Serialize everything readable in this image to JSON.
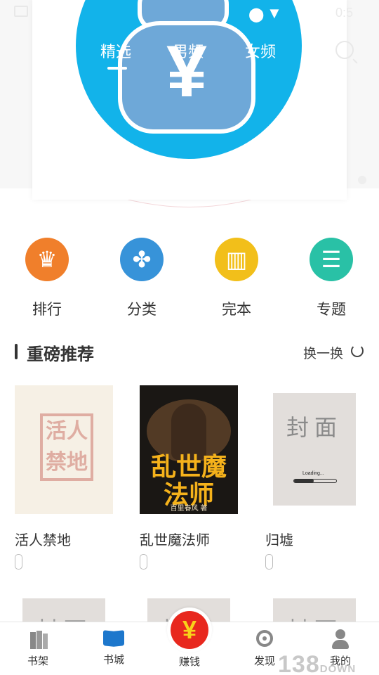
{
  "status_bar": {
    "time": "0:5"
  },
  "banner": {
    "symbol": "¥"
  },
  "tabs": [
    {
      "label": "精选",
      "active": true
    },
    {
      "label": "男频",
      "active": false
    },
    {
      "label": "女频",
      "active": false
    }
  ],
  "quick_links": [
    {
      "label": "排行",
      "icon": "crown-icon",
      "color": "#f07f2b"
    },
    {
      "label": "分类",
      "icon": "clover-icon",
      "color": "#3793d9"
    },
    {
      "label": "完本",
      "icon": "books-icon",
      "color": "#f2bf1a"
    },
    {
      "label": "专题",
      "icon": "document-icon",
      "color": "#29c1a6"
    }
  ],
  "section": {
    "title": "重磅推荐",
    "refresh_label": "换一换"
  },
  "books": [
    {
      "title": "活人禁地",
      "cover_text": "活人禁地"
    },
    {
      "title": "乱世魔法师",
      "cover_text": "乱世魔法师",
      "cover_author": "百里春风 著"
    },
    {
      "title": "归墟",
      "cover_text": "封面",
      "loading_text": "Loading..."
    }
  ],
  "row2_placeholder": "封面",
  "bottom_nav": [
    {
      "label": "书架",
      "icon": "bookshelf-icon"
    },
    {
      "label": "书城",
      "icon": "open-book-icon"
    },
    {
      "label": "赚钱",
      "icon": "yen-coin-icon",
      "symbol": "¥"
    },
    {
      "label": "发现",
      "icon": "discover-icon"
    },
    {
      "label": "我的",
      "icon": "profile-icon"
    }
  ],
  "watermark": {
    "text": "138",
    "suffix": "DOWN"
  }
}
